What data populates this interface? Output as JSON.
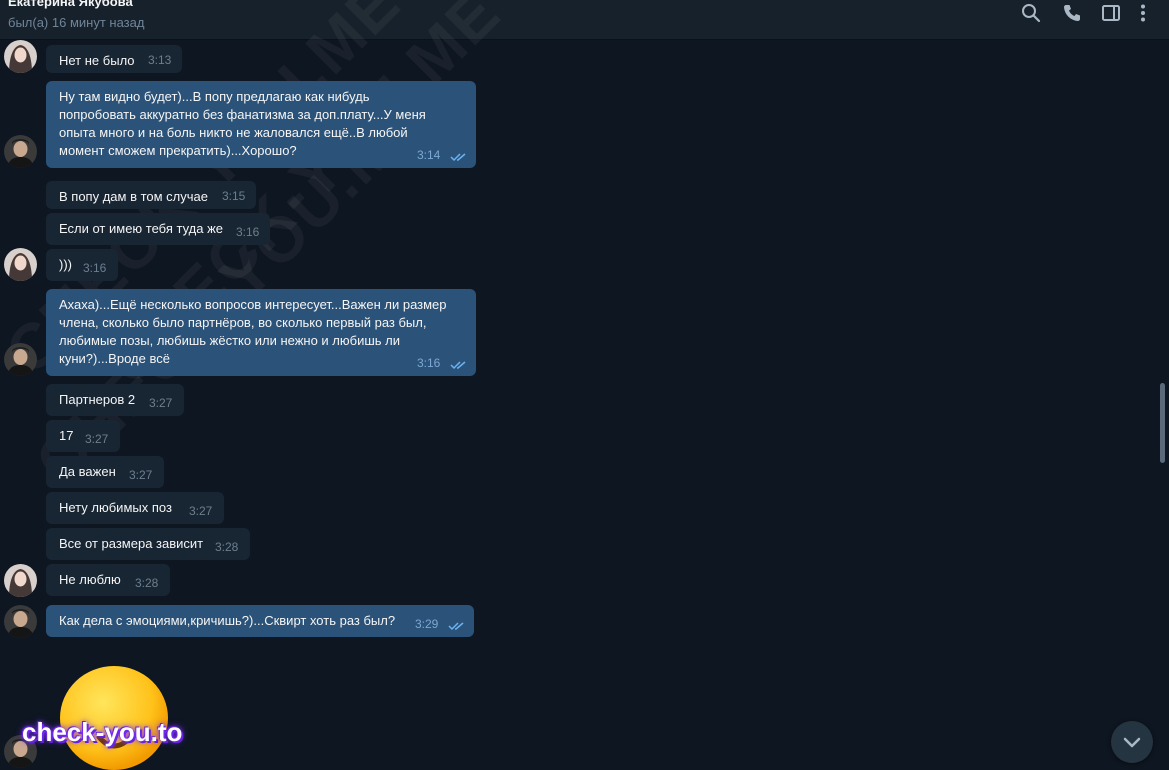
{
  "header": {
    "name": "Екатерина Якубова",
    "status": "был(а) 16 минут назад",
    "icons": [
      "search-icon",
      "phone-icon",
      "sidebar-toggle-icon",
      "more-icon"
    ]
  },
  "watermark": "CHECK-YOU.ME",
  "logo": "check-you.to",
  "messages": [
    {
      "text": "Нет не было",
      "time": "3:13",
      "dir": "in"
    },
    {
      "text": "Ну там видно будет)...В попу предлагаю как нибудь\nпопробовать аккуратно без фанатизма за доп.плату...У меня\nопыта много и на боль никто не жаловался ещё..В любой\nмомент сможем прекратить)...Хорошо?",
      "time": "3:14",
      "dir": "out"
    },
    {
      "text": "В попу дам в том случае",
      "time": "3:15",
      "dir": "in"
    },
    {
      "text": "Если от имею тебя туда же",
      "time": "3:16",
      "dir": "in"
    },
    {
      "text": ")))",
      "time": "3:16",
      "dir": "in"
    },
    {
      "text": "Ахаха)...Ещё несколько вопросов интересует...Важен ли размер\nчлена, сколько было партнёров, во сколько первый раз был,\nлюбимые позы, любишь жёстко или нежно и любишь ли\nкуни?)...Вроде всё",
      "time": "3:16",
      "dir": "out"
    },
    {
      "text": "Партнеров 2",
      "time": "3:27",
      "dir": "in"
    },
    {
      "text": "17",
      "time": "3:27",
      "dir": "in"
    },
    {
      "text": "Да важен",
      "time": "3:27",
      "dir": "in"
    },
    {
      "text": "Нету любимых поз",
      "time": "3:27",
      "dir": "in"
    },
    {
      "text": "Все от размера зависит",
      "time": "3:28",
      "dir": "in"
    },
    {
      "text": "Не люблю",
      "time": "3:28",
      "dir": "in"
    },
    {
      "text": "Как дела с эмоциями,кричишь?)...Сквирт хоть раз был?",
      "time": "3:29",
      "dir": "out"
    }
  ],
  "colors": {
    "background": "#0e1621",
    "header": "#17212b",
    "incoming_bubble": "#182533",
    "outgoing_bubble": "#2b5278",
    "read_check": "#6ab3f3"
  }
}
